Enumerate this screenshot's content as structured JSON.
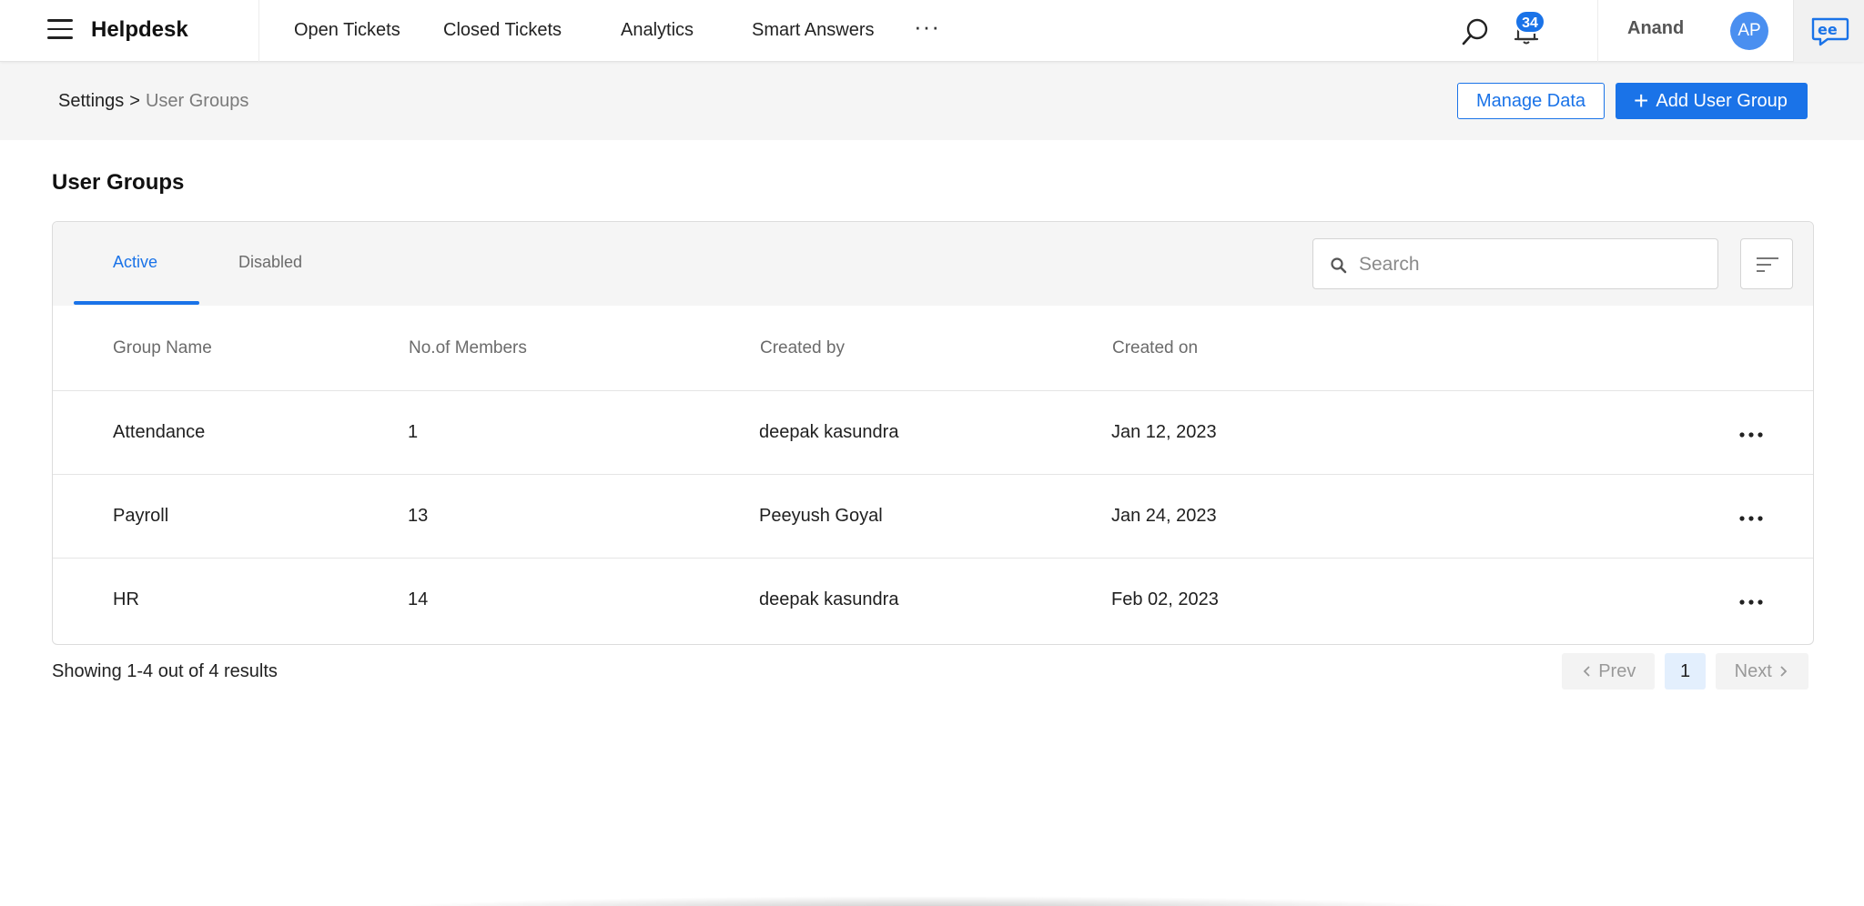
{
  "header": {
    "brand": "Helpdesk",
    "nav": [
      "Open Tickets",
      "Closed Tickets",
      "Analytics",
      "Smart Answers"
    ],
    "more_label": "···",
    "notification_count": "34",
    "user_name": "Anand",
    "avatar_initials": "AP",
    "icons": {
      "menu": "hamburger-icon",
      "search": "search-icon",
      "notifications": "bell-icon",
      "app_logo": "app-logo"
    }
  },
  "subheader": {
    "breadcrumb": {
      "parent": "Settings",
      "separator": ">",
      "current": "User Groups"
    },
    "manage_label": "Manage Data",
    "add_label": "Add User Group",
    "add_icon": "+"
  },
  "page": {
    "title": "User Groups",
    "tabs": [
      {
        "label": "Active",
        "active": true
      },
      {
        "label": "Disabled",
        "active": false
      }
    ],
    "search_placeholder": "Search",
    "columns": [
      "Group Name",
      "No.of Members",
      "Created by",
      "Created on"
    ],
    "rows": [
      {
        "name": "Attendance",
        "members": "1",
        "created_by": "deepak kasundra",
        "created_on": "Jan 12, 2023"
      },
      {
        "name": "Payroll",
        "members": "13",
        "created_by": "Peeyush Goyal",
        "created_on": "Jan 24, 2023"
      },
      {
        "name": "HR",
        "members": "14",
        "created_by": "deepak kasundra",
        "created_on": "Feb 02, 2023"
      }
    ],
    "results_text": "Showing 1-4 out of 4 results",
    "pagination": {
      "prev": "Prev",
      "current": "1",
      "next": "Next"
    }
  },
  "colors": {
    "accent": "#1a73e8",
    "avatar": "#4a8ff0",
    "subheader_bg": "#f5f5f5",
    "muted_text": "#6b6b6b"
  }
}
